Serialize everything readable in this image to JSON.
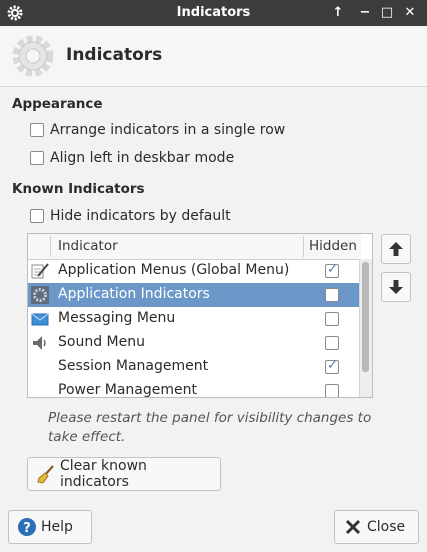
{
  "window": {
    "title": "Indicators",
    "controls": [
      "↑",
      "−",
      "□",
      "✕"
    ]
  },
  "header": {
    "title": "Indicators",
    "icon": "gear-icon"
  },
  "appearance": {
    "heading": "Appearance",
    "options": [
      {
        "label": "Arrange indicators in a single row",
        "checked": false
      },
      {
        "label": "Align left in deskbar mode",
        "checked": false
      }
    ]
  },
  "known": {
    "heading": "Known Indicators",
    "hide_by_default": {
      "label": "Hide indicators by default",
      "checked": false
    },
    "columns": {
      "indicator": "Indicator",
      "hidden": "Hidden"
    },
    "rows": [
      {
        "name": "Application Menus (Global Menu)",
        "hidden": true,
        "selected": false,
        "icon": "pen-icon"
      },
      {
        "name": "Application Indicators",
        "hidden": false,
        "selected": true,
        "icon": "gear-icon"
      },
      {
        "name": "Messaging Menu",
        "hidden": false,
        "selected": false,
        "icon": "mail-icon"
      },
      {
        "name": "Sound Menu",
        "hidden": false,
        "selected": false,
        "icon": "speaker-icon"
      },
      {
        "name": "Session Management",
        "hidden": true,
        "selected": false,
        "icon": ""
      },
      {
        "name": "Power Management",
        "hidden": false,
        "selected": false,
        "icon": ""
      }
    ],
    "note": "Please restart the panel for visibility changes to take effect.",
    "clear_button": "Clear known indicators"
  },
  "footer": {
    "help": "Help",
    "close": "Close"
  },
  "colors": {
    "titlebar": "#3c3c3c",
    "selection": "#6b98c8",
    "check": "#4a78b4"
  }
}
